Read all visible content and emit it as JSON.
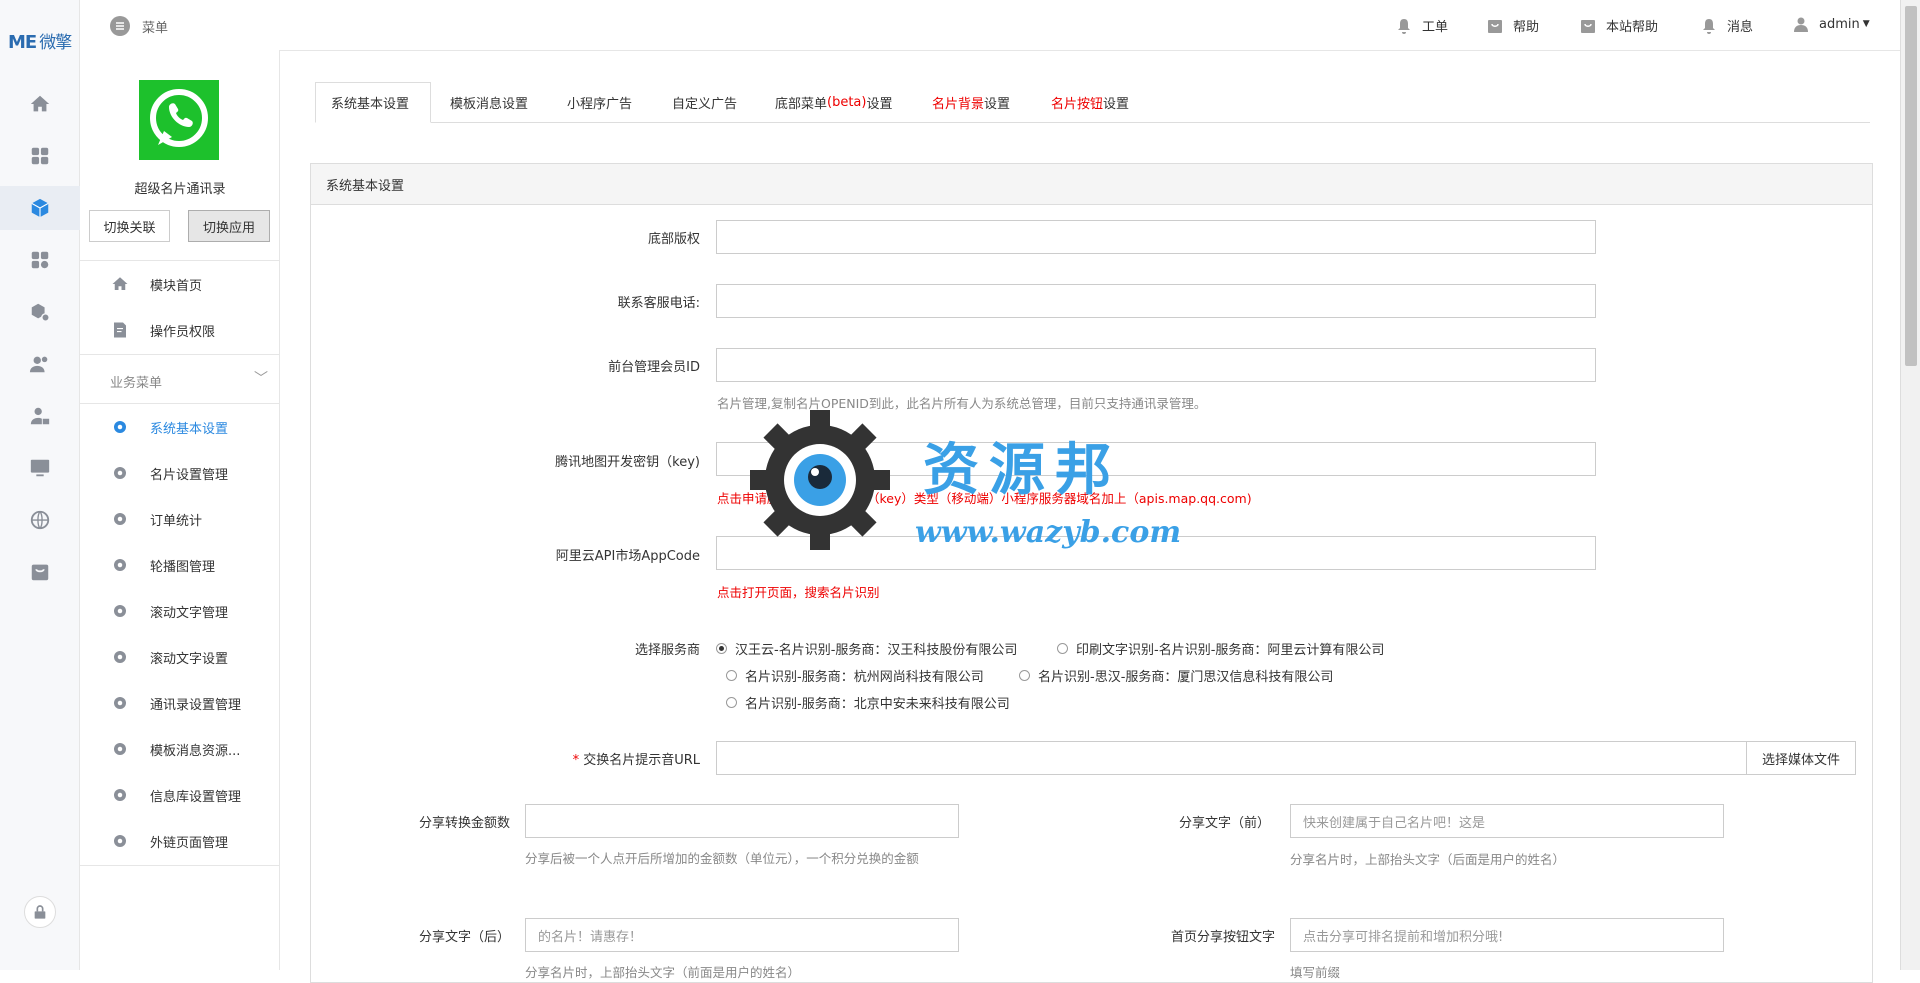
{
  "brand": {
    "logo_text": "ME",
    "logo_cn": "微擎"
  },
  "header": {
    "menu_label": "菜单",
    "nav": [
      {
        "label": "工单",
        "icon": "bell-icon"
      },
      {
        "label": "帮助",
        "icon": "bag-icon"
      },
      {
        "label": "本站帮助",
        "icon": "bag-icon"
      },
      {
        "label": "消息",
        "icon": "bell-icon"
      },
      {
        "label": "admin",
        "icon": "user-icon"
      }
    ]
  },
  "sidebar": {
    "app_name": "超级名片通讯录",
    "switch_link": "切换关联",
    "switch_app": "切换应用",
    "top_items": [
      {
        "label": "模块首页"
      },
      {
        "label": "操作员权限"
      }
    ],
    "group_label": "业务菜单",
    "items": [
      {
        "label": "系统基本设置"
      },
      {
        "label": "名片设置管理"
      },
      {
        "label": "订单统计"
      },
      {
        "label": "轮播图管理"
      },
      {
        "label": "滚动文字管理"
      },
      {
        "label": "滚动文字设置"
      },
      {
        "label": "通讯录设置管理"
      },
      {
        "label": "模板消息资源..."
      },
      {
        "label": "信息库设置管理"
      },
      {
        "label": "外链页面管理"
      }
    ]
  },
  "tabs": {
    "t0": "系统基本设置",
    "t1": "模板消息设置",
    "t2": "小程序广告",
    "t3": "自定义广告",
    "t4a": "底部菜单",
    "t4b": "(beta)",
    "t4c": "设置",
    "t5a": "名片",
    "t5b": "背景",
    "t5c": "设置",
    "t6a": "名片",
    "t6b": "按钮",
    "t6c": "设置"
  },
  "panel": {
    "title": "系统基本设置"
  },
  "form": {
    "copyright_label": "底部版权",
    "phone_label": "联系客服电话:",
    "admin_label": "前台管理会员ID",
    "admin_help": "名片管理,复制名片OPENID到此，此名片所有人为系统总管理，目前只支持通讯录管理。",
    "map_label": "腾讯地图开发密钥（key)",
    "map_help": "点击申请腾讯地图开发密钥（key）类型（移动端）小程序服务器域名加上（apis.map.qq.com)",
    "appcode_label": "阿里云API市场AppCode",
    "appcode_help": "点击打开页面，搜索名片识别",
    "provider_label": "选择服务商",
    "providers": [
      {
        "label": "汉王云-名片识别-服务商：汉王科技股份有限公司",
        "checked": true
      },
      {
        "label": "印刷文字识别-名片识别-服务商：阿里云计算有限公司",
        "checked": false
      },
      {
        "label": "名片识别-服务商：杭州网尚科技有限公司",
        "checked": false
      },
      {
        "label": "名片识别-思汉-服务商：厦门思汉信息科技有限公司",
        "checked": false
      },
      {
        "label": "名片识别-服务商：北京中安未来科技有限公司",
        "checked": false
      }
    ],
    "required_mark": "*",
    "sound_label": "交换名片提示音URL",
    "media_button": "选择媒体文件",
    "amount_label": "分享转换金额数",
    "amount_help": "分享后被一个人点开后所增加的金额数（单位元），一个积分兑换的金额",
    "share_front_label": "分享文字（前）",
    "share_front_value": "快来创建属于自己名片吧！这是",
    "share_front_help": "分享名片时，上部抬头文字（后面是用户的姓名）",
    "share_back_label": "分享文字（后）",
    "share_back_value": "的名片！请惠存！",
    "share_back_help": "分享名片时，上部抬头文字（前面是用户的姓名）",
    "home_share_label": "首页分享按钮文字",
    "home_share_value": "点击分享可排名提前和增加积分哦!",
    "home_share_help": "填写前缀"
  },
  "watermark": {
    "title": "资源邦",
    "url": "www.wazyb.com"
  }
}
